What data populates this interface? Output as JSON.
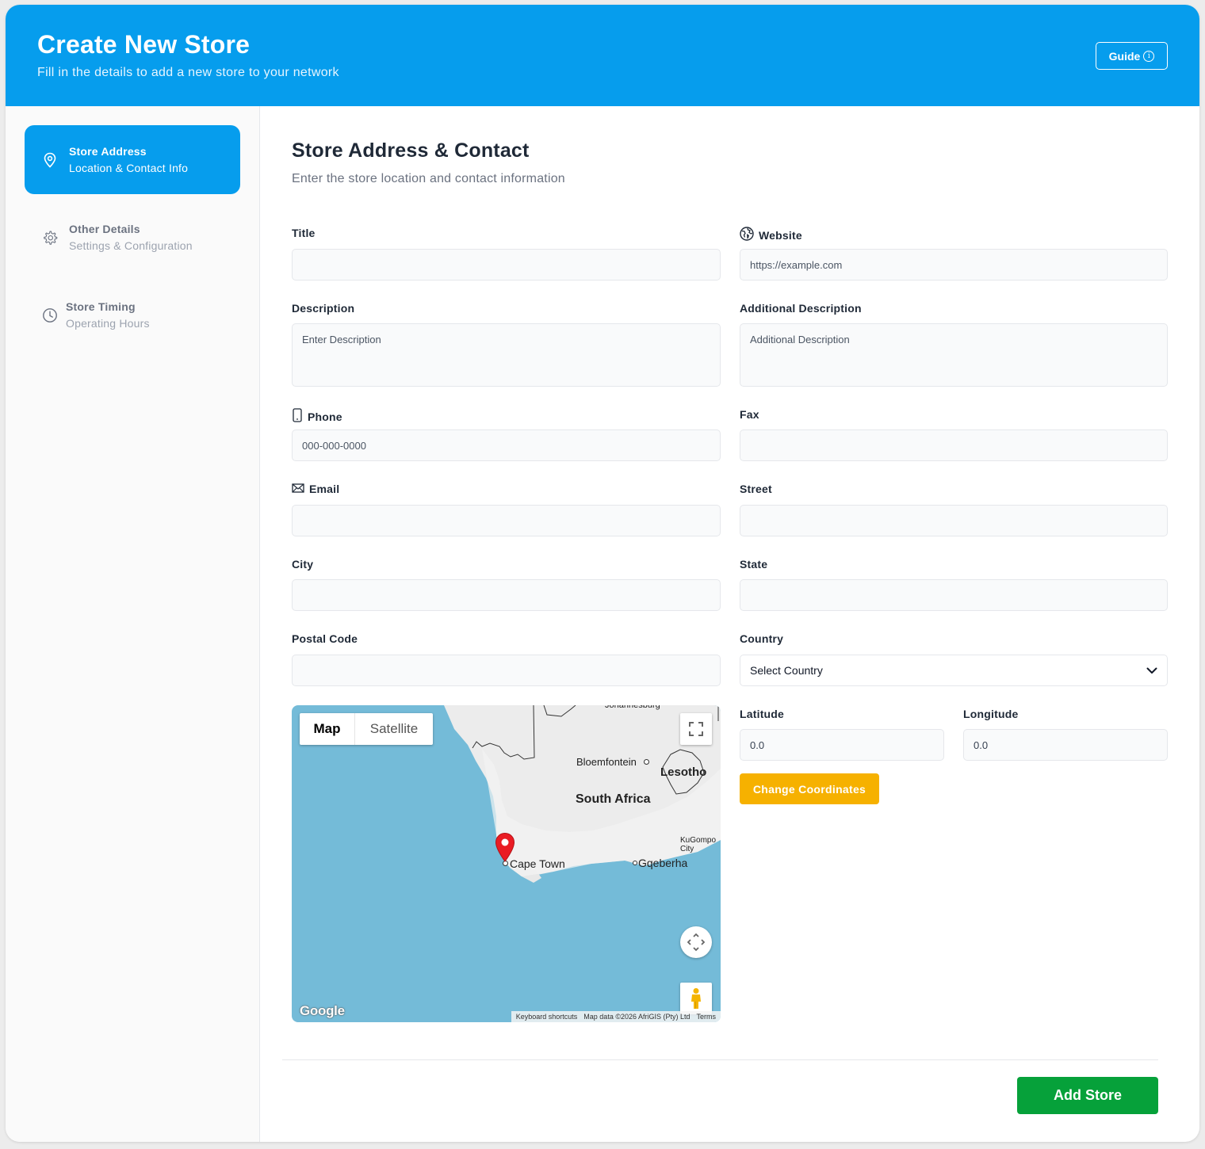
{
  "header": {
    "title": "Create New Store",
    "subtitle": "Fill in the details to add a new store to your network",
    "guide_label": "Guide",
    "guide_icon": "info-icon"
  },
  "colors": {
    "primary": "#069ded",
    "warning": "#f6b100",
    "success": "#06a13a"
  },
  "sidebar": {
    "steps": [
      {
        "title": "Store Address",
        "subtitle": "Location & Contact Info",
        "icon": "location-pin-icon",
        "active": true
      },
      {
        "title": "Other Details",
        "subtitle": "Settings & Configuration",
        "icon": "gear-icon",
        "active": false
      },
      {
        "title": "Store Timing",
        "subtitle": "Operating Hours",
        "icon": "clock-icon",
        "active": false
      }
    ]
  },
  "section": {
    "title": "Store Address & Contact",
    "description": "Enter the store location and contact information"
  },
  "fields": {
    "title": {
      "label": "Title",
      "value": "",
      "placeholder": ""
    },
    "website": {
      "label": "Website",
      "value": "",
      "placeholder": "https://example.com",
      "icon": "globe-icon"
    },
    "description": {
      "label": "Description",
      "value": "",
      "placeholder": "Enter Description"
    },
    "additional_description": {
      "label": "Additional Description",
      "value": "",
      "placeholder": "Additional Description"
    },
    "phone": {
      "label": "Phone",
      "value": "",
      "placeholder": "000-000-0000",
      "icon": "phone-icon"
    },
    "fax": {
      "label": "Fax",
      "value": "",
      "placeholder": ""
    },
    "email": {
      "label": "Email",
      "value": "",
      "placeholder": "",
      "icon": "envelope-icon"
    },
    "street": {
      "label": "Street",
      "value": "",
      "placeholder": ""
    },
    "city": {
      "label": "City",
      "value": "",
      "placeholder": ""
    },
    "state": {
      "label": "State",
      "value": "",
      "placeholder": ""
    },
    "postal_code": {
      "label": "Postal Code",
      "value": "",
      "placeholder": ""
    },
    "country": {
      "label": "Country",
      "value": "Select Country"
    },
    "latitude": {
      "label": "Latitude",
      "value": "0.0"
    },
    "longitude": {
      "label": "Longitude",
      "value": "0.0"
    }
  },
  "map": {
    "tabs": [
      "Map",
      "Satellite"
    ],
    "active_tab": "Map",
    "labels": {
      "country": "South Africa",
      "bloemfontein": "Bloemfontein",
      "lesotho": "Lesotho",
      "cape_town": "Cape Town",
      "gqeberha": "Gqeberha",
      "kugompo": "KuGompo",
      "city": "City",
      "johannesburg": "Johannesburg"
    },
    "brand": "Google",
    "attribution": [
      "Keyboard shortcuts",
      "Map data ©2026 AfriGIS (Pty) Ltd",
      "Terms"
    ]
  },
  "buttons": {
    "change_coordinates": "Change Coordinates",
    "add_store": "Add Store"
  }
}
